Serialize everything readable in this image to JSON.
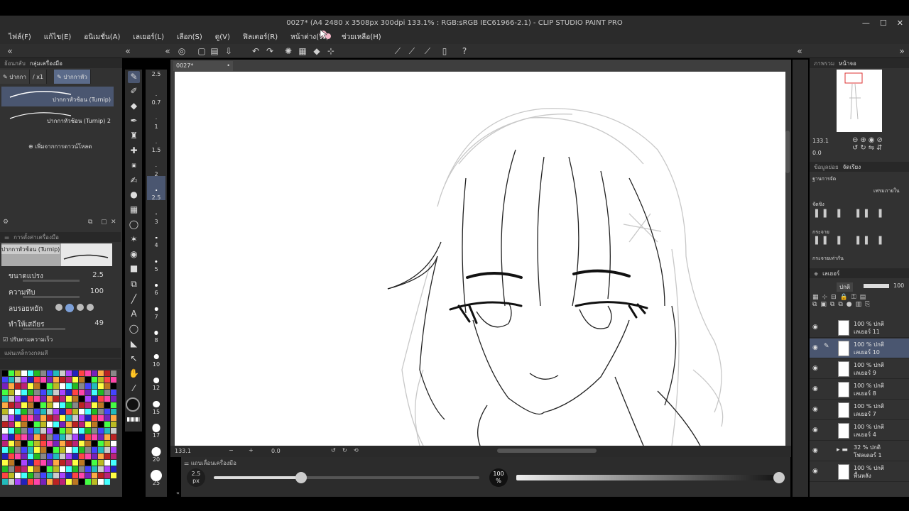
{
  "window": {
    "title": "0027* (A4 2480 x 3508px 300dpi 133.1% : RGB:sRGB IEC61966-2.1) - CLIP STUDIO PAINT PRO",
    "controls": [
      "—",
      "☐",
      "✕"
    ]
  },
  "menu": [
    "ไฟล์(F)",
    "แก้ไข(E)",
    "อนิเมชั่น(A)",
    "เลเยอร์(L)",
    "เลือก(S)",
    "ดู(V)",
    "ฟิลเตอร์(R)",
    "หน้าต่าง(W)",
    "ช่วยเหลือ(H)"
  ],
  "left_panel": {
    "header_tabs": [
      "ย้อนกลับ",
      "กลุ่มเครื่องมือ"
    ],
    "sub_tools": [
      "ปากกา",
      "x1",
      "ปากกาหัว"
    ],
    "brushes": [
      "ปากกาหัวช้อน (Turnip)",
      "ปากกาหัวช้อน (Turnip) 2"
    ],
    "add_download": "เพิ่มจากการดาวน์โหลด",
    "settings_header": "การตั้งค่าเครื่องมือ",
    "preview_name": "ปากกาหัวช้อน (Turnip)",
    "props": [
      {
        "label": "ขนาดแปรง",
        "value": "2.5"
      },
      {
        "label": "ความทึบ",
        "value": "100"
      },
      {
        "label": "ลบรอยหยัก",
        "value": ""
      },
      {
        "label": "ทำให้เสถียร",
        "value": "49"
      }
    ],
    "checkbox_label": "ปรับตามความเร็ว",
    "color_header": "แผ่นเหล็กวงกลมสี"
  },
  "size_column": [
    "2.5",
    "0.7",
    "1",
    "1.5",
    "2",
    "2.5",
    "3",
    "4",
    "5",
    "6",
    "7",
    "8",
    "10",
    "12",
    "15",
    "17",
    "20",
    "25"
  ],
  "canvas": {
    "doc_tab": "0027*",
    "status_zoom": "133.1",
    "status_angle": "0.0"
  },
  "tool_belt": {
    "label": "แถบเลื่อนเครื่องมือ",
    "size_value": "2.5",
    "size_unit": "px",
    "opacity_value": "100",
    "opacity_unit": "%",
    "size_fraction": 0.33,
    "opacity_fraction": 1.0
  },
  "right_panel": {
    "navigator_tabs": [
      "ภาพรวม",
      "หน้าจอ"
    ],
    "zoom": "133.1",
    "angle": "0.0",
    "align_tabs": [
      "ข้อมูลย่อย",
      "จัดเรียง"
    ],
    "align_labels": [
      "ฐานการจัด",
      "จัดชิง",
      "กระจาย",
      "กระจายเท่ากัน"
    ],
    "align_target": "เฟรมภายใน",
    "layer_tab": "เลเยอร์",
    "blend_mode": "ปกติ",
    "opacity": "100",
    "layers": [
      {
        "pct": "100 %",
        "mode": "ปกติ",
        "name": "เลเยอร์ 11",
        "selected": false
      },
      {
        "pct": "100 %",
        "mode": "ปกติ",
        "name": "เลเยอร์ 10",
        "selected": true
      },
      {
        "pct": "100 %",
        "mode": "ปกติ",
        "name": "เลเยอร์ 9",
        "selected": false
      },
      {
        "pct": "100 %",
        "mode": "ปกติ",
        "name": "เลเยอร์ 8",
        "selected": false
      },
      {
        "pct": "100 %",
        "mode": "ปกติ",
        "name": "เลเยอร์ 7",
        "selected": false
      },
      {
        "pct": "100 %",
        "mode": "ปกติ",
        "name": "เลเยอร์ 4",
        "selected": false
      },
      {
        "pct": "32 %",
        "mode": "ปกติ",
        "name": "โฟลเดอร์ 1",
        "selected": false
      },
      {
        "pct": "100 %",
        "mode": "ปกติ",
        "name": "พื้นหลัง",
        "selected": false
      }
    ]
  },
  "colors": {
    "accent": "#4a5670",
    "panel": "#323232",
    "bg": "#2b2b2b"
  }
}
